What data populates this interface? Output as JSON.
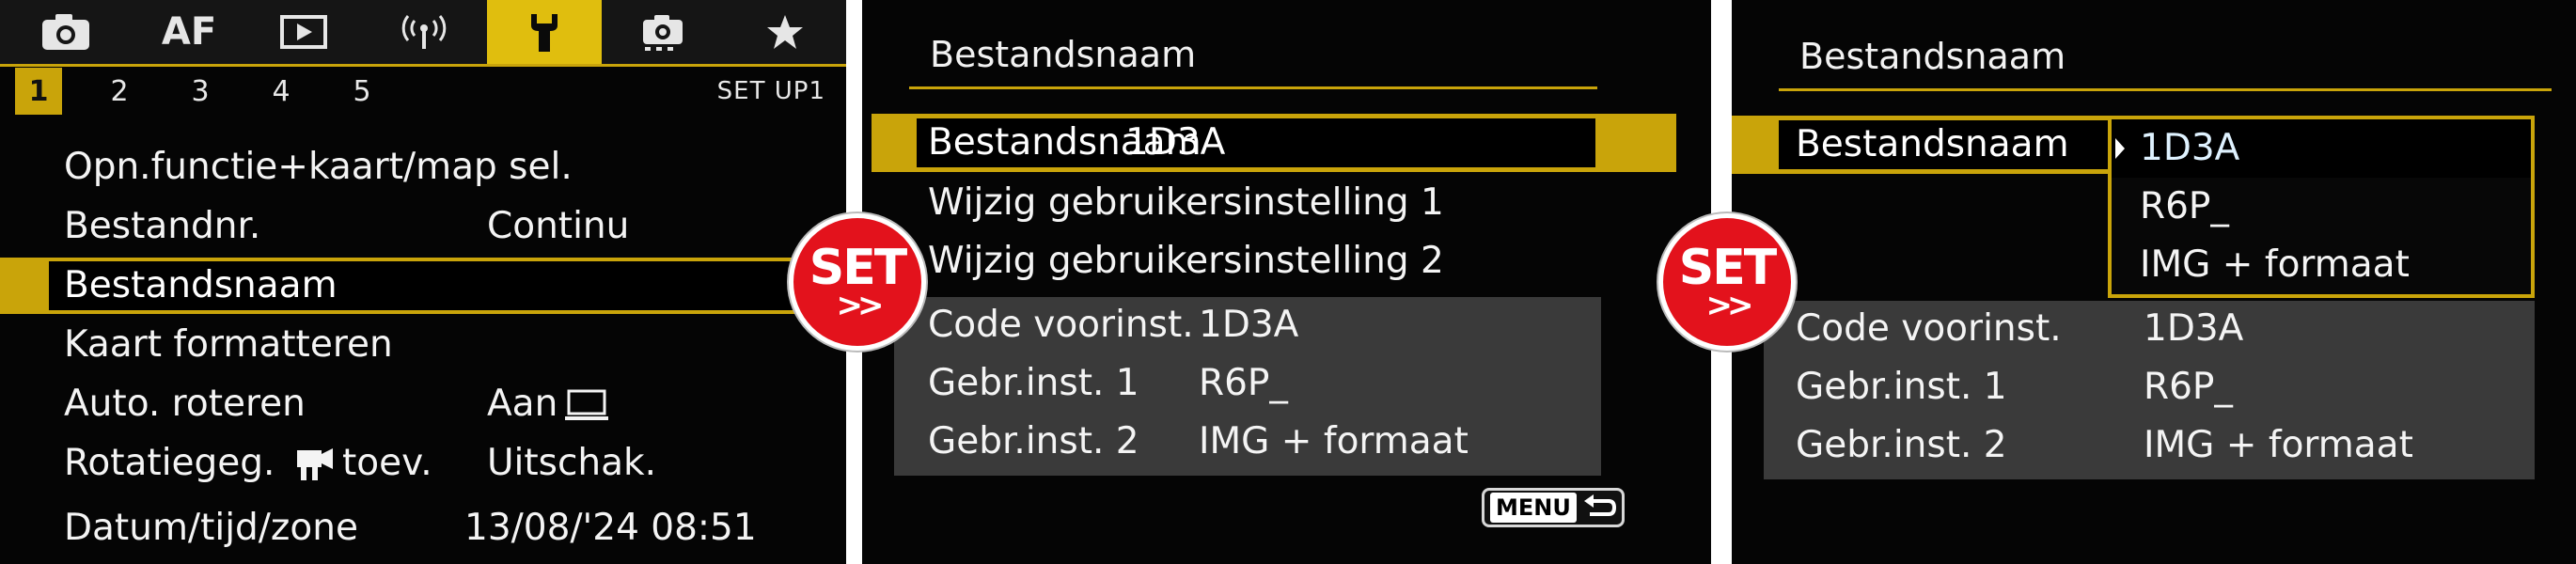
{
  "screen1": {
    "tabs": [
      {
        "icon": "camera-icon",
        "label": ""
      },
      {
        "icon": "af-icon",
        "label": "AF"
      },
      {
        "icon": "playback-icon",
        "label": ""
      },
      {
        "icon": "wireless-icon",
        "label": ""
      },
      {
        "icon": "wrench-icon",
        "label": "",
        "active": true
      },
      {
        "icon": "custom-camera-icon",
        "label": ""
      },
      {
        "icon": "star-icon",
        "label": ""
      }
    ],
    "subtabs": [
      "1",
      "2",
      "3",
      "4",
      "5"
    ],
    "active_subtab": "1",
    "setup_label": "SET UP1",
    "items": [
      {
        "label": "Opn.functie+kaart/map sel.",
        "value": ""
      },
      {
        "label": "Bestandnr.",
        "value": "Continu"
      },
      {
        "label": "Bestandsnaam",
        "value": "",
        "selected": true
      },
      {
        "label": "Kaart formatteren",
        "value": ""
      },
      {
        "label": "Auto. roteren",
        "value": "Aan"
      },
      {
        "label": "Rotatiegeg.",
        "label_suffix": "toev.",
        "value": "Uitschak."
      },
      {
        "label": "Datum/tijd/zone",
        "value": "13/08/'24 08:51"
      }
    ]
  },
  "badge": {
    "text": "SET",
    "arrows": ">>"
  },
  "screen2": {
    "title": "Bestandsnaam",
    "selected_row": {
      "label": "Bestandsnaam",
      "value": "1D3A"
    },
    "options": [
      "Wijzig gebruikersinstelling 1",
      "Wijzig gebruikersinstelling 2"
    ],
    "info": [
      {
        "label": "Code voorinst.",
        "value": "1D3A"
      },
      {
        "label": "Gebr.inst. 1",
        "value": "R6P_"
      },
      {
        "label": "Gebr.inst. 2",
        "value": "IMG + formaat"
      }
    ],
    "menu_button": "MENU"
  },
  "screen3": {
    "title": "Bestandsnaam",
    "row_label": "Bestandsnaam",
    "dropdown": [
      "1D3A",
      "R6P_",
      "IMG + formaat"
    ],
    "dropdown_current": "1D3A",
    "info": [
      {
        "label": "Code voorinst.",
        "value": "1D3A"
      },
      {
        "label": "Gebr.inst. 1",
        "value": "R6P_"
      },
      {
        "label": "Gebr.inst. 2",
        "value": "IMG + formaat"
      }
    ]
  },
  "colors": {
    "accent": "#c9a40a",
    "tab_active": "#e0be0e",
    "badge_red": "#e3121c",
    "panel_grey": "#3a3a3a"
  }
}
